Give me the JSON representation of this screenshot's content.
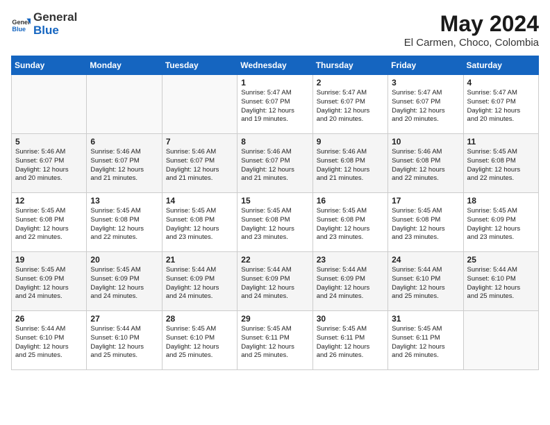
{
  "header": {
    "logo_general": "General",
    "logo_blue": "Blue",
    "title": "May 2024",
    "location": "El Carmen, Choco, Colombia"
  },
  "weekdays": [
    "Sunday",
    "Monday",
    "Tuesday",
    "Wednesday",
    "Thursday",
    "Friday",
    "Saturday"
  ],
  "weeks": [
    [
      {
        "day": "",
        "text": ""
      },
      {
        "day": "",
        "text": ""
      },
      {
        "day": "",
        "text": ""
      },
      {
        "day": "1",
        "text": "Sunrise: 5:47 AM\nSunset: 6:07 PM\nDaylight: 12 hours\nand 19 minutes."
      },
      {
        "day": "2",
        "text": "Sunrise: 5:47 AM\nSunset: 6:07 PM\nDaylight: 12 hours\nand 20 minutes."
      },
      {
        "day": "3",
        "text": "Sunrise: 5:47 AM\nSunset: 6:07 PM\nDaylight: 12 hours\nand 20 minutes."
      },
      {
        "day": "4",
        "text": "Sunrise: 5:47 AM\nSunset: 6:07 PM\nDaylight: 12 hours\nand 20 minutes."
      }
    ],
    [
      {
        "day": "5",
        "text": "Sunrise: 5:46 AM\nSunset: 6:07 PM\nDaylight: 12 hours\nand 20 minutes."
      },
      {
        "day": "6",
        "text": "Sunrise: 5:46 AM\nSunset: 6:07 PM\nDaylight: 12 hours\nand 21 minutes."
      },
      {
        "day": "7",
        "text": "Sunrise: 5:46 AM\nSunset: 6:07 PM\nDaylight: 12 hours\nand 21 minutes."
      },
      {
        "day": "8",
        "text": "Sunrise: 5:46 AM\nSunset: 6:07 PM\nDaylight: 12 hours\nand 21 minutes."
      },
      {
        "day": "9",
        "text": "Sunrise: 5:46 AM\nSunset: 6:08 PM\nDaylight: 12 hours\nand 21 minutes."
      },
      {
        "day": "10",
        "text": "Sunrise: 5:46 AM\nSunset: 6:08 PM\nDaylight: 12 hours\nand 22 minutes."
      },
      {
        "day": "11",
        "text": "Sunrise: 5:45 AM\nSunset: 6:08 PM\nDaylight: 12 hours\nand 22 minutes."
      }
    ],
    [
      {
        "day": "12",
        "text": "Sunrise: 5:45 AM\nSunset: 6:08 PM\nDaylight: 12 hours\nand 22 minutes."
      },
      {
        "day": "13",
        "text": "Sunrise: 5:45 AM\nSunset: 6:08 PM\nDaylight: 12 hours\nand 22 minutes."
      },
      {
        "day": "14",
        "text": "Sunrise: 5:45 AM\nSunset: 6:08 PM\nDaylight: 12 hours\nand 23 minutes."
      },
      {
        "day": "15",
        "text": "Sunrise: 5:45 AM\nSunset: 6:08 PM\nDaylight: 12 hours\nand 23 minutes."
      },
      {
        "day": "16",
        "text": "Sunrise: 5:45 AM\nSunset: 6:08 PM\nDaylight: 12 hours\nand 23 minutes."
      },
      {
        "day": "17",
        "text": "Sunrise: 5:45 AM\nSunset: 6:08 PM\nDaylight: 12 hours\nand 23 minutes."
      },
      {
        "day": "18",
        "text": "Sunrise: 5:45 AM\nSunset: 6:09 PM\nDaylight: 12 hours\nand 23 minutes."
      }
    ],
    [
      {
        "day": "19",
        "text": "Sunrise: 5:45 AM\nSunset: 6:09 PM\nDaylight: 12 hours\nand 24 minutes."
      },
      {
        "day": "20",
        "text": "Sunrise: 5:45 AM\nSunset: 6:09 PM\nDaylight: 12 hours\nand 24 minutes."
      },
      {
        "day": "21",
        "text": "Sunrise: 5:44 AM\nSunset: 6:09 PM\nDaylight: 12 hours\nand 24 minutes."
      },
      {
        "day": "22",
        "text": "Sunrise: 5:44 AM\nSunset: 6:09 PM\nDaylight: 12 hours\nand 24 minutes."
      },
      {
        "day": "23",
        "text": "Sunrise: 5:44 AM\nSunset: 6:09 PM\nDaylight: 12 hours\nand 24 minutes."
      },
      {
        "day": "24",
        "text": "Sunrise: 5:44 AM\nSunset: 6:10 PM\nDaylight: 12 hours\nand 25 minutes."
      },
      {
        "day": "25",
        "text": "Sunrise: 5:44 AM\nSunset: 6:10 PM\nDaylight: 12 hours\nand 25 minutes."
      }
    ],
    [
      {
        "day": "26",
        "text": "Sunrise: 5:44 AM\nSunset: 6:10 PM\nDaylight: 12 hours\nand 25 minutes."
      },
      {
        "day": "27",
        "text": "Sunrise: 5:44 AM\nSunset: 6:10 PM\nDaylight: 12 hours\nand 25 minutes."
      },
      {
        "day": "28",
        "text": "Sunrise: 5:45 AM\nSunset: 6:10 PM\nDaylight: 12 hours\nand 25 minutes."
      },
      {
        "day": "29",
        "text": "Sunrise: 5:45 AM\nSunset: 6:11 PM\nDaylight: 12 hours\nand 25 minutes."
      },
      {
        "day": "30",
        "text": "Sunrise: 5:45 AM\nSunset: 6:11 PM\nDaylight: 12 hours\nand 26 minutes."
      },
      {
        "day": "31",
        "text": "Sunrise: 5:45 AM\nSunset: 6:11 PM\nDaylight: 12 hours\nand 26 minutes."
      },
      {
        "day": "",
        "text": ""
      }
    ]
  ]
}
